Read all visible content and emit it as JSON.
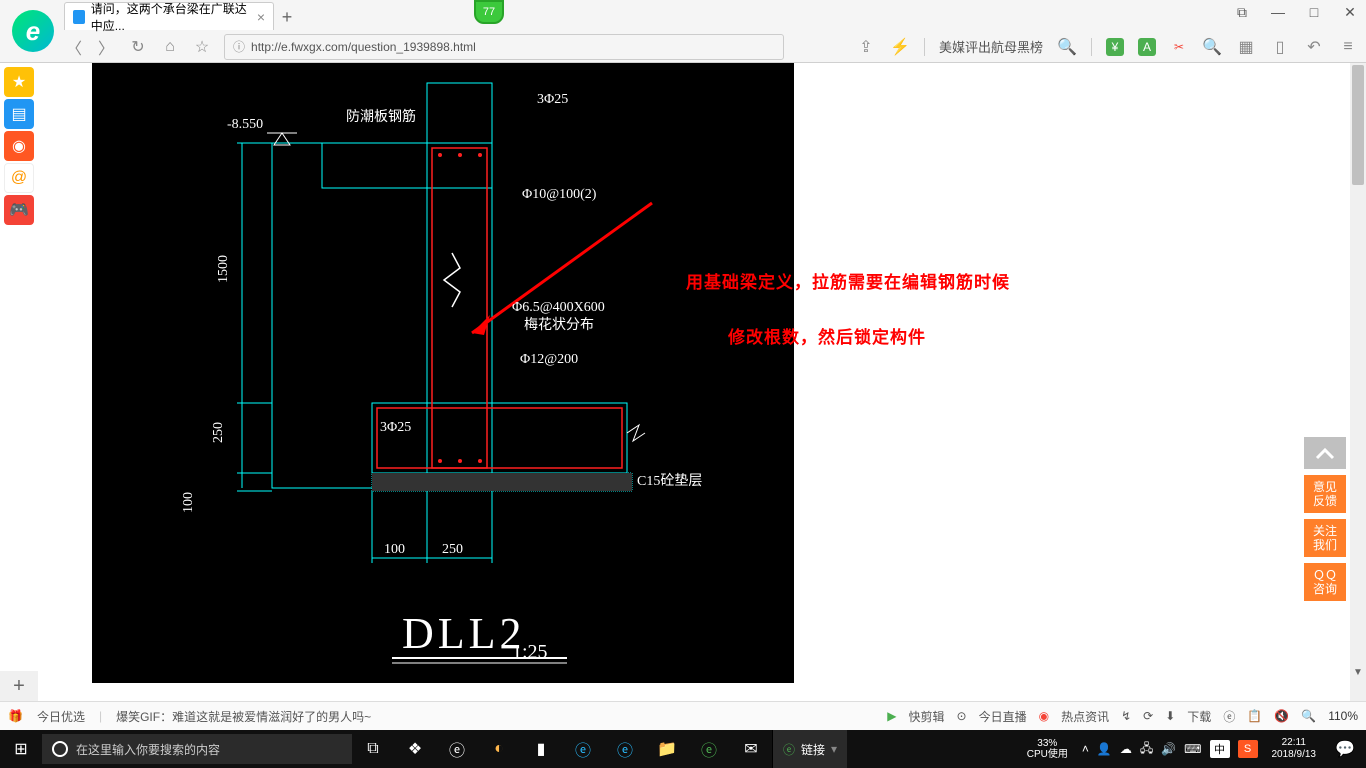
{
  "browser": {
    "tab_title": "请问，这两个承台梁在广联达中应...",
    "url": "http://e.fwxgx.com/question_1939898.html",
    "badge": "77",
    "hot_text": "美媒评出航母黑榜"
  },
  "annotation": {
    "line1": "用基础梁定义，拉筋需要在编辑钢筋时候",
    "line2": "修改根数，然后锁定构件"
  },
  "cad": {
    "level": "-8.550",
    "label1": "防潮板钢筋",
    "rebar_top": "3Φ25",
    "rebar_stirrup": "Φ10@100(2)",
    "rebar_tie": "Φ6.5@400X600",
    "tie_note": "梅花状分布",
    "rebar_side": "Φ12@200",
    "rebar_bottom": "3Φ25",
    "bedding": "C15砼垫层",
    "dim_h": "1500",
    "dim_250": "250",
    "dim_100a": "100",
    "dim_100b": "100",
    "dim_250b": "250",
    "title": "DLL2",
    "scale": "1:25"
  },
  "right_buttons": {
    "b1": "意见\n反馈",
    "b2": "关注\n我们",
    "b3": "ＱＱ\n咨询"
  },
  "status": {
    "today": "今日优选",
    "news": "爆笑GIF：难道这就是被爱情滋润好了的男人吗~",
    "kuaijian": "快剪辑",
    "live": "今日直播",
    "hot": "热点资讯",
    "download": "下载",
    "zoom": "110%"
  },
  "taskbar": {
    "search_placeholder": "在这里输入你要搜索的内容",
    "link": "链接",
    "cpu_pct": "33%",
    "cpu_label": "CPU使用",
    "ime": "中",
    "time": "22:11",
    "date": "2018/9/13"
  }
}
